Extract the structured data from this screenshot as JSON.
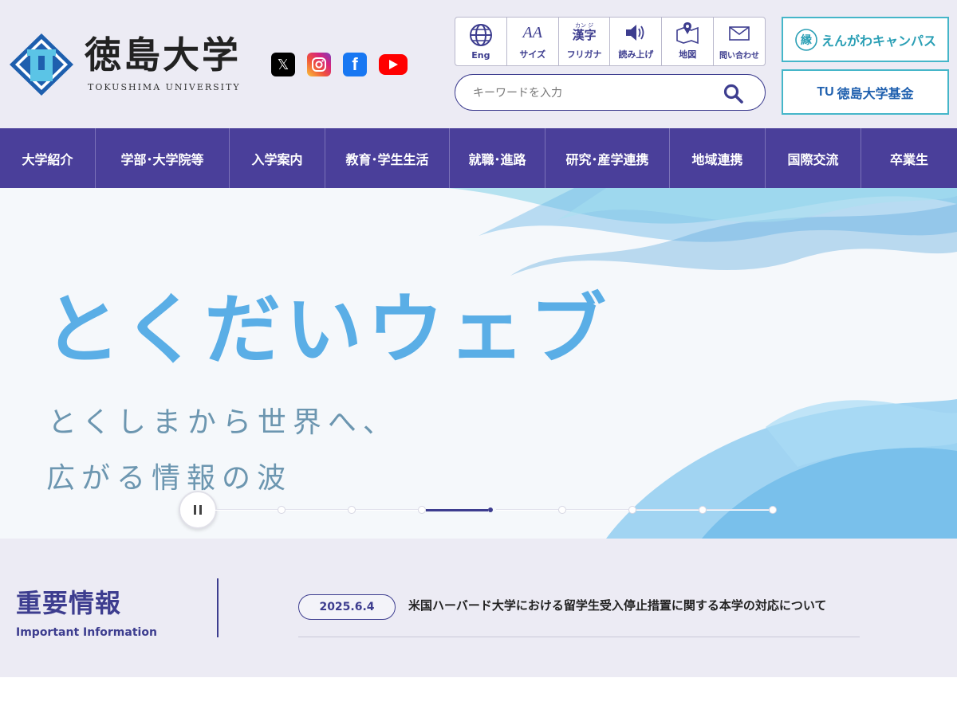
{
  "header": {
    "logo_jp": "徳島大学",
    "logo_en": "TOKUSHIMA UNIVERSITY",
    "sns": [
      {
        "name": "x-icon",
        "glyph": "𝕏"
      },
      {
        "name": "instagram-icon"
      },
      {
        "name": "facebook-icon",
        "glyph": "f"
      },
      {
        "name": "youtube-icon"
      }
    ],
    "tools": [
      {
        "label": "Eng",
        "icon": "globe-icon"
      },
      {
        "label": "サイズ",
        "icon": "font-size-icon",
        "glyph": "AA"
      },
      {
        "label": "フリガナ",
        "icon": "kanji-icon",
        "ruby": "カン ジ",
        "glyph": "漢字"
      },
      {
        "label": "読み上げ",
        "icon": "speaker-icon"
      },
      {
        "label": "地図",
        "icon": "map-icon"
      },
      {
        "label": "問い合わせ",
        "icon": "mail-icon"
      }
    ],
    "search_placeholder": "キーワードを入力",
    "engawa_label": "えんがわキャンパス",
    "engawa_mark": "縁",
    "fund_label": "徳島大学基金",
    "fund_mark": "TU"
  },
  "nav": [
    "大学紹介",
    "学部･大学院等",
    "入学案内",
    "教育･学生生活",
    "就職･進路",
    "研究･産学連携",
    "地域連携",
    "国際交流",
    "卒業生"
  ],
  "hero": {
    "title": "とくだいウェブ",
    "subtitle_1": "とくしまから世界へ、",
    "subtitle_2": "広がる情報の波",
    "slide_count": 9,
    "active_slide": 4
  },
  "important": {
    "title": "重要情報",
    "subtitle": "Important Information",
    "items": [
      {
        "date": "2025.6.4",
        "text": "米国ハーバード大学における留学生受入停止措置に関する本学の対応について"
      }
    ]
  },
  "colors": {
    "brand": "#4a3f9a",
    "accent": "#3d3d8f",
    "teal": "#45b6c9",
    "header_bg": "#ecebf4"
  }
}
